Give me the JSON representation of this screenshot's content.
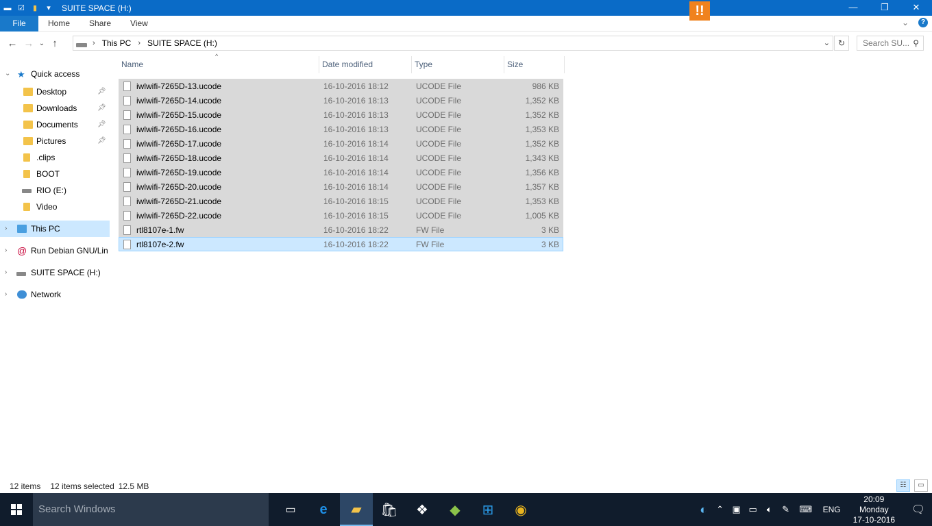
{
  "window": {
    "title": "SUITE SPACE (H:)",
    "minimize": "—",
    "maximize": "❐",
    "close": "✕"
  },
  "ribbon": {
    "file": "File",
    "tabs": [
      "Home",
      "Share",
      "View"
    ],
    "help": "?"
  },
  "address": {
    "crumbs": [
      "This PC",
      "SUITE SPACE (H:)"
    ],
    "search_placeholder": "Search SU..."
  },
  "nav_pane": [
    {
      "label": "Quick access",
      "icon": "star-icon",
      "expander": "expanded",
      "pinned": false,
      "level": 0
    },
    {
      "label": "Desktop",
      "icon": "folder-icon",
      "pinned": true,
      "level": 1
    },
    {
      "label": "Downloads",
      "icon": "download-folder-icon",
      "pinned": true,
      "level": 1
    },
    {
      "label": "Documents",
      "icon": "documents-folder-icon",
      "pinned": true,
      "level": 1
    },
    {
      "label": "Pictures",
      "icon": "pictures-folder-icon",
      "pinned": true,
      "level": 1
    },
    {
      "label": ".clips",
      "icon": "folder-icon",
      "pinned": false,
      "level": 1
    },
    {
      "label": "BOOT",
      "icon": "folder-icon",
      "pinned": false,
      "level": 1
    },
    {
      "label": "RIO (E:)",
      "icon": "drive-icon",
      "pinned": false,
      "level": 1
    },
    {
      "label": "Video",
      "icon": "folder-icon",
      "pinned": false,
      "level": 1
    },
    {
      "label": "This PC",
      "icon": "computer-icon",
      "expander": "collapsed",
      "level": 0,
      "selected": true
    },
    {
      "label": "Run Debian GNU/Lin",
      "icon": "debian-icon",
      "expander": "collapsed",
      "level": 0
    },
    {
      "label": "SUITE SPACE (H:)",
      "icon": "drive-icon",
      "expander": "collapsed",
      "level": 0
    },
    {
      "label": "Network",
      "icon": "network-icon",
      "expander": "collapsed",
      "level": 0
    }
  ],
  "columns": {
    "name": "Name",
    "date": "Date modified",
    "type": "Type",
    "size": "Size"
  },
  "files": [
    {
      "name": "iwlwifi-7265D-13.ucode",
      "date": "16-10-2016 18:12",
      "type": "UCODE File",
      "size": "986 KB"
    },
    {
      "name": "iwlwifi-7265D-14.ucode",
      "date": "16-10-2016 18:13",
      "type": "UCODE File",
      "size": "1,352 KB"
    },
    {
      "name": "iwlwifi-7265D-15.ucode",
      "date": "16-10-2016 18:13",
      "type": "UCODE File",
      "size": "1,352 KB"
    },
    {
      "name": "iwlwifi-7265D-16.ucode",
      "date": "16-10-2016 18:13",
      "type": "UCODE File",
      "size": "1,353 KB"
    },
    {
      "name": "iwlwifi-7265D-17.ucode",
      "date": "16-10-2016 18:14",
      "type": "UCODE File",
      "size": "1,352 KB"
    },
    {
      "name": "iwlwifi-7265D-18.ucode",
      "date": "16-10-2016 18:14",
      "type": "UCODE File",
      "size": "1,343 KB"
    },
    {
      "name": "iwlwifi-7265D-19.ucode",
      "date": "16-10-2016 18:14",
      "type": "UCODE File",
      "size": "1,356 KB"
    },
    {
      "name": "iwlwifi-7265D-20.ucode",
      "date": "16-10-2016 18:14",
      "type": "UCODE File",
      "size": "1,357 KB"
    },
    {
      "name": "iwlwifi-7265D-21.ucode",
      "date": "16-10-2016 18:15",
      "type": "UCODE File",
      "size": "1,353 KB"
    },
    {
      "name": "iwlwifi-7265D-22.ucode",
      "date": "16-10-2016 18:15",
      "type": "UCODE File",
      "size": "1,005 KB"
    },
    {
      "name": "rtl8107e-1.fw",
      "date": "16-10-2016 18:22",
      "type": "FW File",
      "size": "3 KB"
    },
    {
      "name": "rtl8107e-2.fw",
      "date": "16-10-2016 18:22",
      "type": "FW File",
      "size": "3 KB",
      "focused": true
    }
  ],
  "status": {
    "count": "12 items",
    "selected": "12 items selected",
    "size": "12.5 MB"
  },
  "taskbar": {
    "search_placeholder": "Search Windows",
    "apps": [
      "task-view-icon",
      "edge-icon",
      "file-explorer-icon",
      "store-icon",
      "dropbox-icon",
      "bluestacks-icon",
      "windows-icon",
      "chrome-icon"
    ],
    "active_app": "file-explorer-icon",
    "language": "ENG",
    "time": "20:09",
    "day": "Monday",
    "date": "17-10-2016"
  },
  "colors": {
    "titlebar": "#0a6bc7",
    "selection": "#cce8ff",
    "selected_row": "#d9d9d9",
    "taskbar": "#101c2c"
  }
}
